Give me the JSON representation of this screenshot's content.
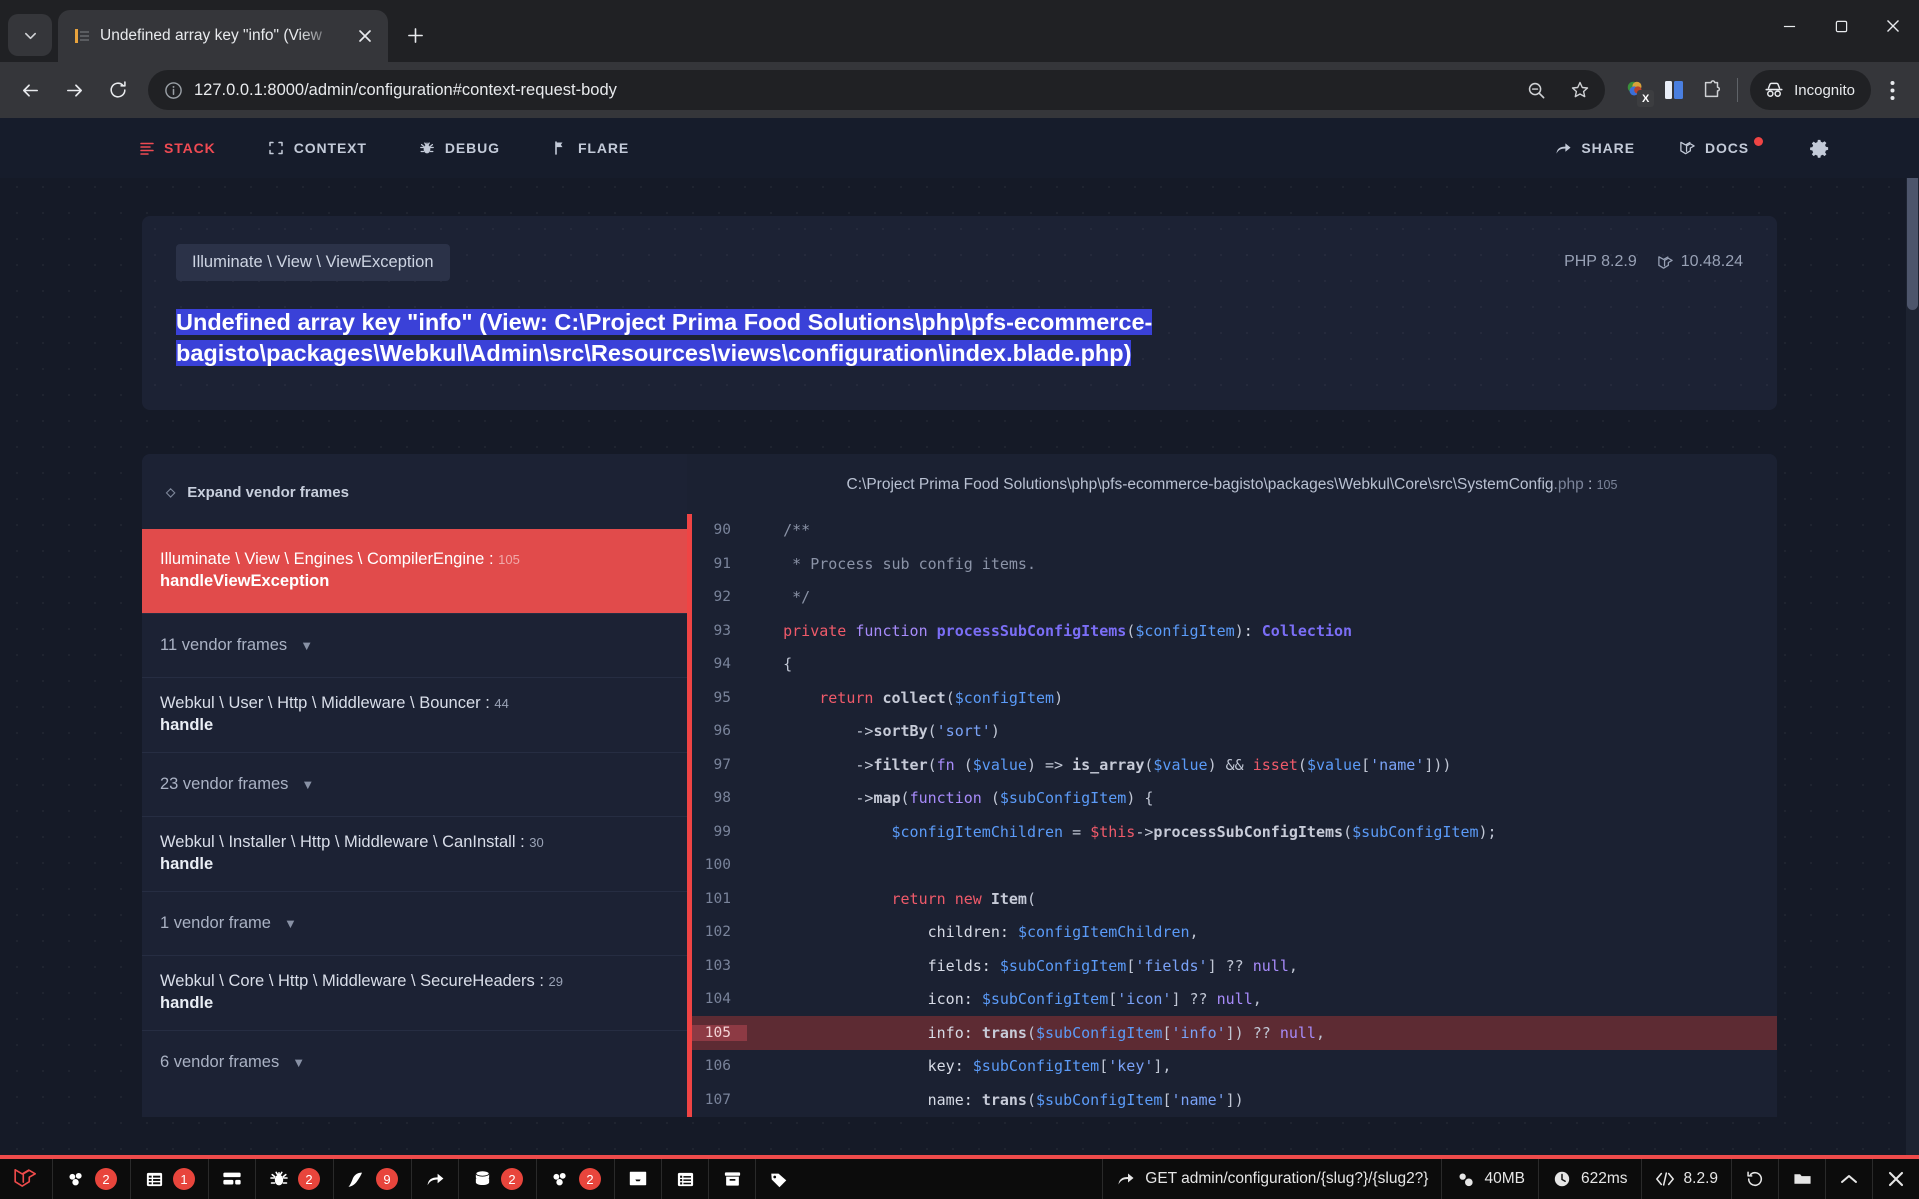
{
  "browser": {
    "tab": {
      "title": "Undefined array key \"info\" (View",
      "favicon": "flare-favicon"
    },
    "url": "127.0.0.1:8000/admin/configuration#context-request-body",
    "profile_label": "Incognito",
    "new_tab_label": "+",
    "tab_close_label": "×",
    "window": {
      "minimize": "—",
      "maximize": "☐",
      "close": "✕"
    }
  },
  "flare_nav": {
    "left": [
      {
        "label": "STACK",
        "icon": "stack-icon",
        "active": true
      },
      {
        "label": "CONTEXT",
        "icon": "context-icon",
        "active": false
      },
      {
        "label": "DEBUG",
        "icon": "bug-icon",
        "active": false
      },
      {
        "label": "FLARE",
        "icon": "flare-icon",
        "active": false
      }
    ],
    "right": [
      {
        "label": "SHARE",
        "icon": "share-icon",
        "badge": false
      },
      {
        "label": "DOCS",
        "icon": "laravel-icon",
        "badge": true
      }
    ],
    "settings_icon": "gear-icon",
    "active_color": "#ef4a53"
  },
  "exception": {
    "class": "Illuminate \\ View \\ ViewException",
    "message": "Undefined array key \"info\" (View: C:\\Project Prima Food Solutions\\php\\pfs-ecommerce-bagisto\\packages\\Webkul\\Admin\\src\\Resources\\views\\configuration\\index.blade.php)",
    "php_version": "PHP 8.2.9",
    "laravel_version": "10.48.24",
    "selection_color": "#3a41d8"
  },
  "stack": {
    "expand_label": "Expand vendor frames",
    "frames": [
      {
        "type": "frame",
        "class": "Illuminate \\ View \\ Engines \\ CompilerEngine",
        "line": "105",
        "method": "handleViewException",
        "active": true
      },
      {
        "type": "vendor",
        "label": "11 vendor frames"
      },
      {
        "type": "frame",
        "class": "Webkul \\ User \\ Http \\ Middleware \\ Bouncer",
        "line": "44",
        "method": "handle",
        "active": false
      },
      {
        "type": "vendor",
        "label": "23 vendor frames"
      },
      {
        "type": "frame",
        "class": "Webkul \\ Installer \\ Http \\ Middleware \\ CanInstall",
        "line": "30",
        "method": "handle",
        "active": false
      },
      {
        "type": "vendor",
        "label": "1 vendor frame"
      },
      {
        "type": "frame",
        "class": "Webkul \\ Core \\ Http \\ Middleware \\ SecureHeaders",
        "line": "29",
        "method": "handle",
        "active": false
      },
      {
        "type": "vendor",
        "label": "6 vendor frames"
      }
    ]
  },
  "code": {
    "file_path": "C:\\Project Prima Food Solutions\\php\\pfs-ecommerce-bagisto\\packages\\Webkul\\Core\\src\\SystemConfig",
    "file_ext": ".php",
    "file_line": "105",
    "error_line": 105,
    "lines": [
      {
        "n": "90",
        "tokens": [
          [
            "plain",
            "    "
          ],
          [
            "cmt",
            "/**"
          ]
        ]
      },
      {
        "n": "91",
        "tokens": [
          [
            "plain",
            "     "
          ],
          [
            "cmt",
            "* Process sub config items."
          ]
        ]
      },
      {
        "n": "92",
        "tokens": [
          [
            "plain",
            "     "
          ],
          [
            "cmt",
            "*/"
          ]
        ]
      },
      {
        "n": "93",
        "tokens": [
          [
            "plain",
            "    "
          ],
          [
            "key",
            "private "
          ],
          [
            "key2",
            "function "
          ],
          [
            "fnb",
            "processSubConfigItems"
          ],
          [
            "punc",
            "("
          ],
          [
            "var",
            "$configItem"
          ],
          [
            "punc",
            ")"
          ],
          [
            "plain",
            ": "
          ],
          [
            "type",
            "Collection"
          ]
        ]
      },
      {
        "n": "94",
        "tokens": [
          [
            "plain",
            "    "
          ],
          [
            "punc",
            "{"
          ]
        ]
      },
      {
        "n": "95",
        "tokens": [
          [
            "plain",
            "        "
          ],
          [
            "key",
            "return "
          ],
          [
            "fn",
            "collect"
          ],
          [
            "punc",
            "("
          ],
          [
            "var",
            "$configItem"
          ],
          [
            "punc",
            ")"
          ]
        ]
      },
      {
        "n": "96",
        "tokens": [
          [
            "plain",
            "            "
          ],
          [
            "punc",
            "->"
          ],
          [
            "fn",
            "sortBy"
          ],
          [
            "punc",
            "("
          ],
          [
            "str",
            "'sort'"
          ],
          [
            "punc",
            ")"
          ]
        ]
      },
      {
        "n": "97",
        "tokens": [
          [
            "plain",
            "            "
          ],
          [
            "punc",
            "->"
          ],
          [
            "fn",
            "filter"
          ],
          [
            "punc",
            "("
          ],
          [
            "key2",
            "fn "
          ],
          [
            "punc",
            "("
          ],
          [
            "var",
            "$value"
          ],
          [
            "punc",
            ") => "
          ],
          [
            "fn",
            "is_array"
          ],
          [
            "punc",
            "("
          ],
          [
            "var",
            "$value"
          ],
          [
            "punc",
            ") && "
          ],
          [
            "key",
            "isset"
          ],
          [
            "punc",
            "("
          ],
          [
            "var",
            "$value"
          ],
          [
            "punc",
            "["
          ],
          [
            "str",
            "'name'"
          ],
          [
            "punc",
            "]))"
          ]
        ]
      },
      {
        "n": "98",
        "tokens": [
          [
            "plain",
            "            "
          ],
          [
            "punc",
            "->"
          ],
          [
            "fn",
            "map"
          ],
          [
            "punc",
            "("
          ],
          [
            "key2",
            "function "
          ],
          [
            "punc",
            "("
          ],
          [
            "var",
            "$subConfigItem"
          ],
          [
            "punc",
            ") {"
          ]
        ]
      },
      {
        "n": "99",
        "tokens": [
          [
            "plain",
            "                "
          ],
          [
            "var",
            "$configItemChildren"
          ],
          [
            "punc",
            " = "
          ],
          [
            "key",
            "$this"
          ],
          [
            "punc",
            "->"
          ],
          [
            "fn",
            "processSubConfigItems"
          ],
          [
            "punc",
            "("
          ],
          [
            "var",
            "$subConfigItem"
          ],
          [
            "punc",
            ");"
          ]
        ]
      },
      {
        "n": "100",
        "tokens": [
          [
            "plain",
            ""
          ]
        ]
      },
      {
        "n": "101",
        "tokens": [
          [
            "plain",
            "                "
          ],
          [
            "key",
            "return "
          ],
          [
            "key",
            "new "
          ],
          [
            "fn",
            "Item"
          ],
          [
            "punc",
            "("
          ]
        ]
      },
      {
        "n": "102",
        "tokens": [
          [
            "plain",
            "                    "
          ],
          [
            "plain",
            "children: "
          ],
          [
            "var",
            "$configItemChildren"
          ],
          [
            "punc",
            ","
          ]
        ]
      },
      {
        "n": "103",
        "tokens": [
          [
            "plain",
            "                    "
          ],
          [
            "plain",
            "fields: "
          ],
          [
            "var",
            "$subConfigItem"
          ],
          [
            "punc",
            "["
          ],
          [
            "str",
            "'fields'"
          ],
          [
            "punc",
            "] ?? "
          ],
          [
            "null",
            "null"
          ],
          [
            "punc",
            ","
          ]
        ]
      },
      {
        "n": "104",
        "tokens": [
          [
            "plain",
            "                    "
          ],
          [
            "plain",
            "icon: "
          ],
          [
            "var",
            "$subConfigItem"
          ],
          [
            "punc",
            "["
          ],
          [
            "str",
            "'icon'"
          ],
          [
            "punc",
            "] ?? "
          ],
          [
            "null",
            "null"
          ],
          [
            "punc",
            ","
          ]
        ]
      },
      {
        "n": "105",
        "tokens": [
          [
            "plain",
            "                    "
          ],
          [
            "plain",
            "info: "
          ],
          [
            "fn",
            "trans"
          ],
          [
            "punc",
            "("
          ],
          [
            "var",
            "$subConfigItem"
          ],
          [
            "punc",
            "["
          ],
          [
            "str",
            "'info'"
          ],
          [
            "punc",
            "]) ?? "
          ],
          [
            "null",
            "null"
          ],
          [
            "punc",
            ","
          ]
        ]
      },
      {
        "n": "106",
        "tokens": [
          [
            "plain",
            "                    "
          ],
          [
            "plain",
            "key: "
          ],
          [
            "var",
            "$subConfigItem"
          ],
          [
            "punc",
            "["
          ],
          [
            "str",
            "'key'"
          ],
          [
            "punc",
            "],"
          ]
        ]
      },
      {
        "n": "107",
        "tokens": [
          [
            "plain",
            "                    "
          ],
          [
            "plain",
            "name: "
          ],
          [
            "fn",
            "trans"
          ],
          [
            "punc",
            "("
          ],
          [
            "var",
            "$subConfigItem"
          ],
          [
            "punc",
            "["
          ],
          [
            "str",
            "'name'"
          ],
          [
            "punc",
            "])"
          ]
        ]
      }
    ]
  },
  "debugbar": {
    "logo": "laravel-icon",
    "items": [
      {
        "icon": "messages-icon",
        "badge": "2"
      },
      {
        "icon": "table-icon",
        "badge": "1"
      },
      {
        "icon": "view-icon",
        "badge": ""
      },
      {
        "icon": "bug-icon",
        "badge": "2"
      },
      {
        "icon": "route-icon",
        "badge": "9"
      },
      {
        "icon": "redirect-icon",
        "badge": ""
      },
      {
        "icon": "database-icon",
        "badge": "2"
      },
      {
        "icon": "models-icon",
        "badge": "2"
      },
      {
        "icon": "mail-icon",
        "badge": ""
      },
      {
        "icon": "list-icon",
        "badge": ""
      },
      {
        "icon": "cache-icon",
        "badge": ""
      },
      {
        "icon": "tag-icon",
        "badge": ""
      }
    ],
    "route": "GET admin/configuration/{slug?}/{slug2?}",
    "memory": "40MB",
    "time": "622ms",
    "php": "8.2.9",
    "controls": [
      {
        "icon": "history-icon"
      },
      {
        "icon": "open-icon"
      },
      {
        "icon": "collapse-icon"
      },
      {
        "icon": "close-icon"
      }
    ],
    "accent_color": "#ef4b4b",
    "badge_color": "#e8453c"
  }
}
